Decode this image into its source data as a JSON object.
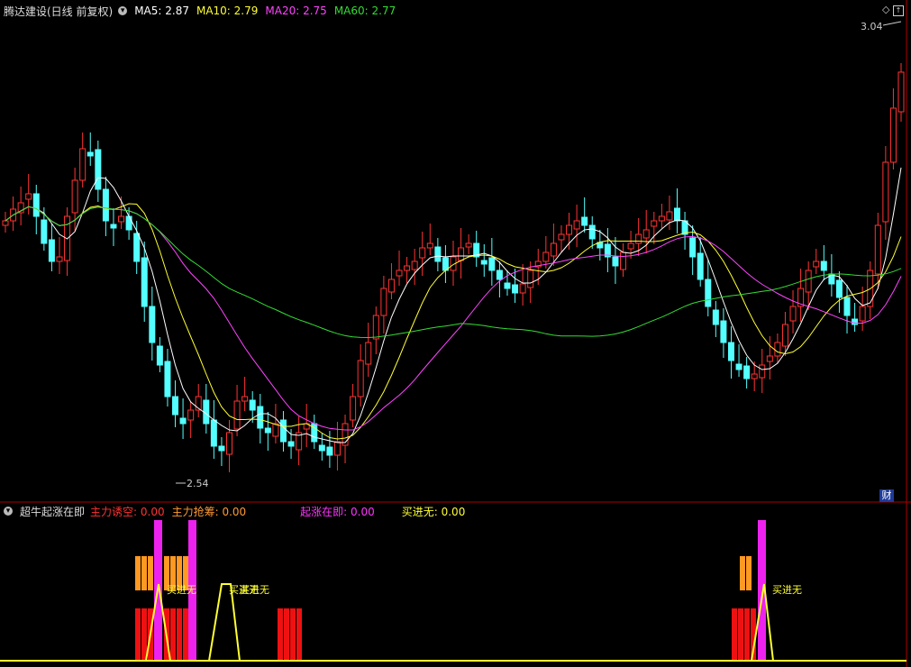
{
  "header": {
    "stock": "腾达建设(日线 前复权)",
    "ma": [
      {
        "label": "MA5: 2.87",
        "color": "#ffffff"
      },
      {
        "label": "MA10: 2.79",
        "color": "#ffff33"
      },
      {
        "label": "MA20: 2.75",
        "color": "#ff44ff"
      },
      {
        "label": "MA60: 2.77",
        "color": "#33dd33"
      }
    ]
  },
  "price": {
    "high_label": "3.04",
    "low_label": "2.54",
    "corner_badge": "财",
    "colors": {
      "up": "#ff3333",
      "down": "#54ffff",
      "ma5": "#ffffff",
      "ma10": "#ffff33",
      "ma20": "#ff44ff",
      "ma60": "#33dd33"
    }
  },
  "indicator": {
    "title": "超牛起涨在即",
    "items": [
      {
        "label": "主力诱空: 0.00",
        "color": "#ff3333"
      },
      {
        "label": "主力抢筹: 0.00",
        "color": "#ff9933"
      },
      {
        "label": "起涨在即: 0.00",
        "color": "#ff33ff"
      },
      {
        "label": "买进无: 0.00",
        "color": "#ffff33"
      }
    ],
    "signal_label": "买进无"
  }
}
